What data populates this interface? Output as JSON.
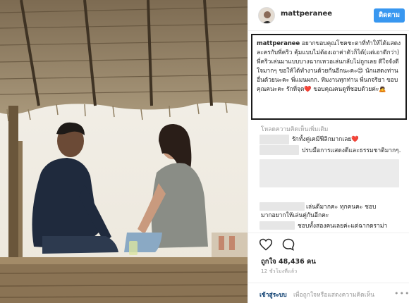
{
  "post": {
    "username": "mattperanee",
    "follow_label": "ติดตาม",
    "caption": {
      "username": "mattperanee",
      "text": "อยากขอบคุณโชคชะตาที่ทำให้ได้แสดงละครกับพี่คริว คุ้มแบบไม่ต้องเอาค่าตัวก็ได้(แต่เอาดีกว่า) พี่คริวเล่นมาแบบบางฉากเหวอเล่นกลับไม่ถูกเลย ดีใจจังดีใจมากๆ ขอให้ได้ทำงานด้วยกันอีกนะคะ😊 นักแสดงท่านอื่นด้วยนะคะ พี่แมนผกก. ทีมงานทุกท่าน พี่นกจริยา ขอบคุณคนะคะ รักที่จุด❤️ ขอบคุณคนดูที่ชอบด้วยค่ะ🙇"
    },
    "load_more": "โหลดความคิดเห็นเพิ่มเติม",
    "comments": [
      {
        "text": "รักทั้งคู่เคมีฟีลิกมากเลย❤️"
      },
      {
        "text": "ปรบมือการแสดงดีและธรรมชาติมากๆ."
      },
      {
        "text": "เล่นดีมากคะ ทุกคนคะ ชอบ"
      },
      {
        "text": "มากอยากให้เล่นคู่กันอีกคะ"
      },
      {
        "text": "ชอบทั้งสองคนเลยค่ะแต่ฉากดราม่า"
      }
    ],
    "likes": "ถูกใจ 48,436 คน",
    "time": "12 ชั่วโมงที่แล้ว",
    "login_label": "เข้าสู่ระบบ",
    "add_comment": "เพื่อถูกใจหรือแสดงความคิดเห็น",
    "more_label": "•••"
  },
  "icons": {
    "like": "heart-icon",
    "comment": "comment-icon",
    "more": "more-options-icon"
  },
  "colors": {
    "follow_button": "#3897f0",
    "login_link": "#003569",
    "heart_emoji": "#e0245e"
  }
}
